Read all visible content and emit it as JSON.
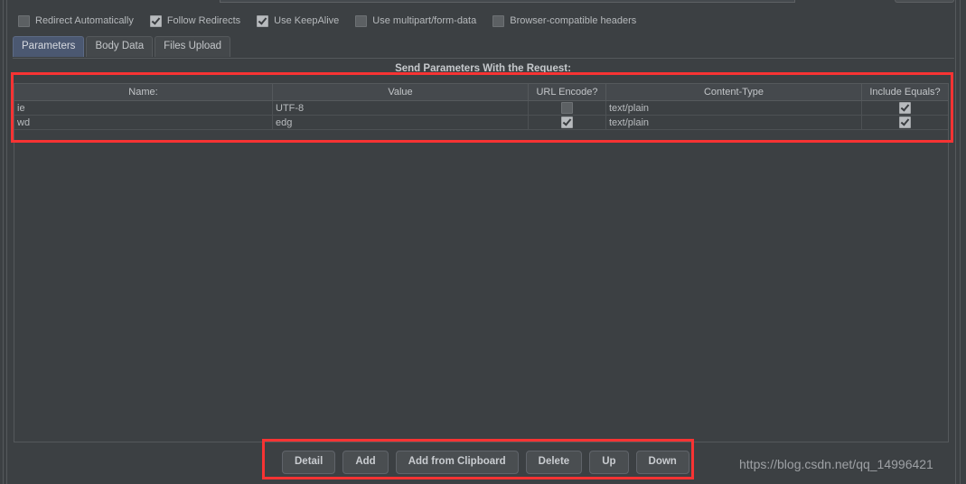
{
  "options": [
    {
      "label": "Redirect Automatically",
      "checked": false
    },
    {
      "label": "Follow Redirects",
      "checked": true
    },
    {
      "label": "Use KeepAlive",
      "checked": true
    },
    {
      "label": "Use multipart/form-data",
      "checked": false
    },
    {
      "label": "Browser-compatible headers",
      "checked": false
    }
  ],
  "tabs": [
    {
      "label": "Parameters",
      "active": true
    },
    {
      "label": "Body Data",
      "active": false
    },
    {
      "label": "Files Upload",
      "active": false
    }
  ],
  "section": {
    "title": "Send Parameters With the Request:"
  },
  "table": {
    "columns": [
      {
        "label": "Name:",
        "key": "name"
      },
      {
        "label": "Value",
        "key": "value"
      },
      {
        "label": "URL Encode?",
        "key": "url_encode"
      },
      {
        "label": "Content-Type",
        "key": "content_type"
      },
      {
        "label": "Include Equals?",
        "key": "include_equals"
      }
    ],
    "rows": [
      {
        "name": "ie",
        "value": "UTF-8",
        "url_encode": false,
        "content_type": "text/plain",
        "include_equals": true
      },
      {
        "name": "wd",
        "value": "edg",
        "url_encode": true,
        "content_type": "text/plain",
        "include_equals": true
      }
    ]
  },
  "buttons": [
    {
      "label": "Detail"
    },
    {
      "label": "Add"
    },
    {
      "label": "Add from Clipboard"
    },
    {
      "label": "Delete"
    },
    {
      "label": "Up"
    },
    {
      "label": "Down"
    }
  ],
  "watermark": {
    "text": "https://blog.csdn.net/qq_14996421"
  },
  "annotations": {
    "accent_color": "#f73333",
    "active_tab_color": "#4b5871",
    "background_color": "#3c4043"
  }
}
